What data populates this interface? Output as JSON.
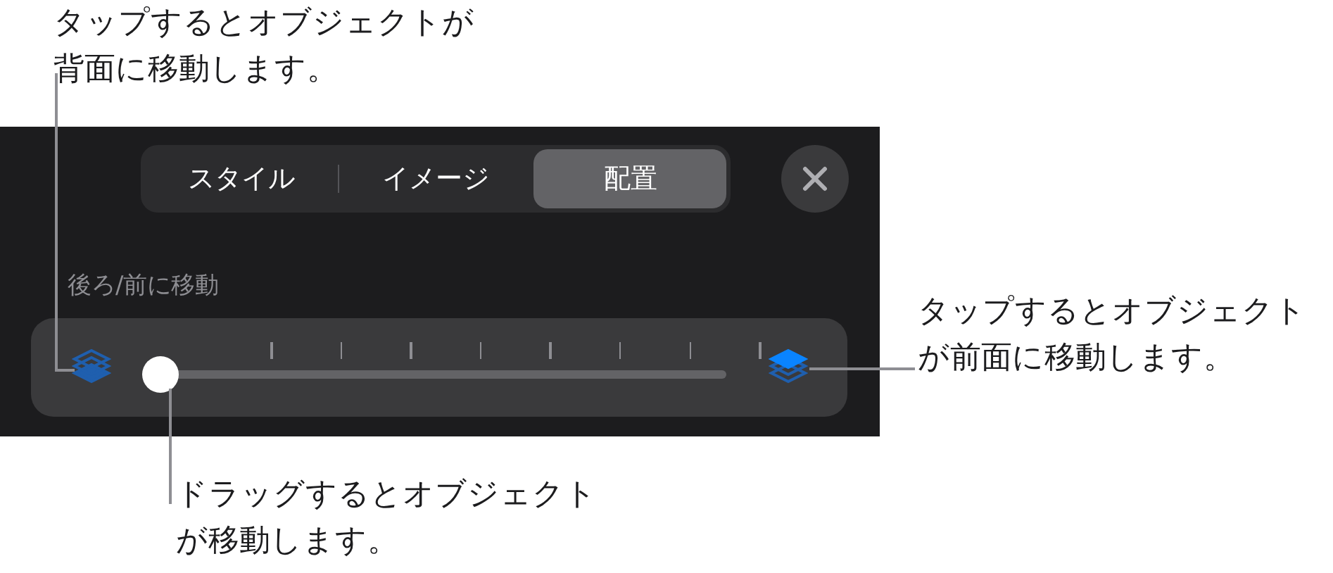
{
  "callouts": [
    {
      "text": "タップするとオブジェクトが背面に移動します。"
    },
    {
      "text": "タップするとオブジェクトが前面に移動します。"
    },
    {
      "text": "ドラッグするとオブジェクトが移動します。"
    }
  ],
  "tabs": [
    {
      "label": "スタイル",
      "selected": false
    },
    {
      "label": "イメージ",
      "selected": false
    },
    {
      "label": "配置",
      "selected": true
    }
  ],
  "section_label": "後ろ/前に移動",
  "slider": {
    "level": 0
  }
}
